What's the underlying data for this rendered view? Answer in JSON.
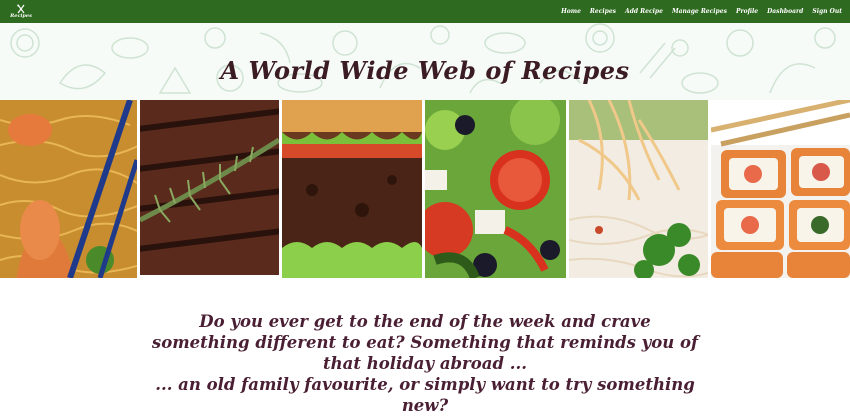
{
  "brand": {
    "logo_mark": "W W W",
    "logo_text": "Recipes"
  },
  "nav": {
    "items": [
      {
        "label": "Home"
      },
      {
        "label": "Recipes"
      },
      {
        "label": "Add Recipe"
      },
      {
        "label": "Manage Recipes"
      },
      {
        "label": "Profile"
      },
      {
        "label": "Dashboard"
      },
      {
        "label": "Sign Out"
      }
    ]
  },
  "banner": {
    "title": "A World Wide Web of Recipes"
  },
  "gallery": {
    "images": [
      {
        "name": "shrimp-noodles-image"
      },
      {
        "name": "steak-rosemary-image"
      },
      {
        "name": "burger-image"
      },
      {
        "name": "greek-salad-image"
      },
      {
        "name": "pasta-parsley-image"
      },
      {
        "name": "sushi-rolls-image"
      }
    ]
  },
  "intro": {
    "line1": "Do you ever get to the end of the week and crave something different to eat? Something that reminds you of that holiday abroad ...",
    "line2": "... an old family favourite, or simply want to try something new?"
  },
  "colors": {
    "nav_bg": "#2e6a1f",
    "title_text": "#3b1c22",
    "intro_text": "#4a1f33"
  }
}
